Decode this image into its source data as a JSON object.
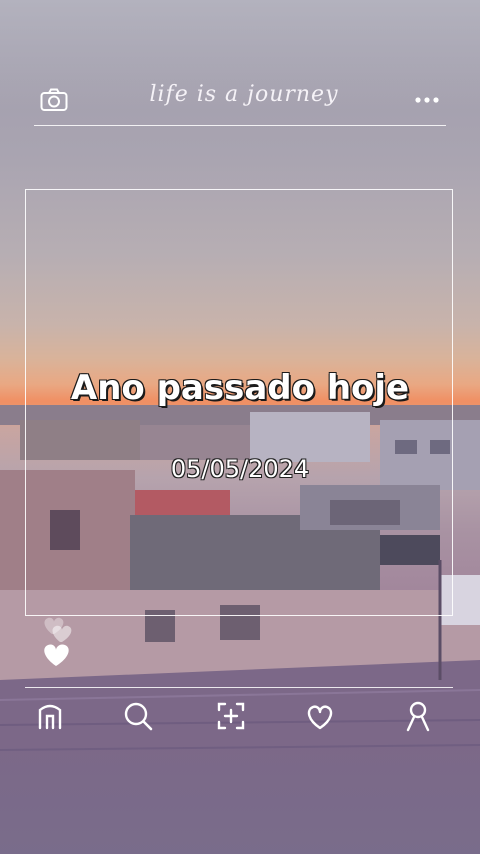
{
  "header": {
    "title": "life is a journey",
    "left_icon": "camera-icon",
    "right_icon": "more-icon"
  },
  "main": {
    "headline": "Ano passado hoje",
    "date": "05/05/2024",
    "reaction_icon": "heart-icon"
  },
  "nav": {
    "items": [
      {
        "icon": "home-icon"
      },
      {
        "icon": "search-icon"
      },
      {
        "icon": "add-icon"
      },
      {
        "icon": "heart-icon"
      },
      {
        "icon": "profile-icon"
      }
    ]
  },
  "colors": {
    "frame": "#ffffff",
    "text": "#ffffff",
    "sunset": "#f08f63"
  }
}
